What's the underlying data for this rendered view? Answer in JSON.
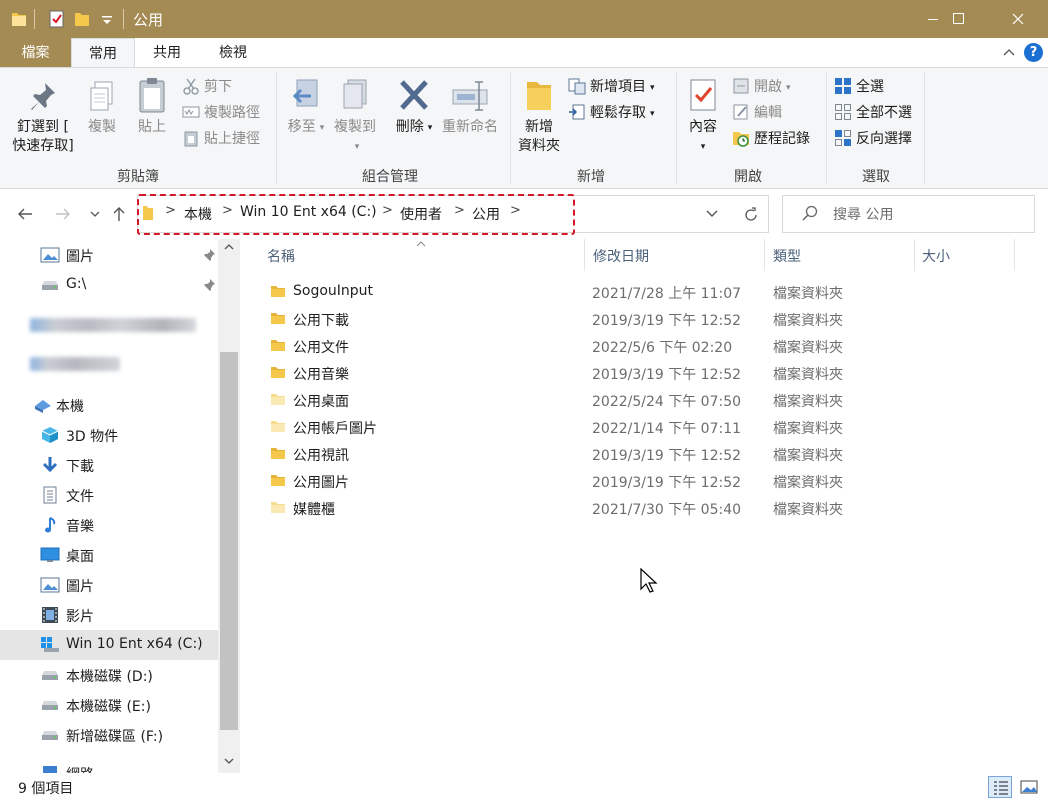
{
  "window": {
    "title": "公用"
  },
  "tabs": {
    "file": "檔案",
    "home": "常用",
    "share": "共用",
    "view": "檢視",
    "help": "?"
  },
  "ribbon": {
    "clipboard": {
      "label": "剪貼簿",
      "pin": "釘選到 [",
      "pin2": "快速存取]",
      "copy": "複製",
      "paste": "貼上",
      "cut": "剪下",
      "copy_path": "複製路徑",
      "paste_shortcut": "貼上捷徑"
    },
    "organize": {
      "label": "組合管理",
      "move_to": "移至",
      "copy_to": "複製到",
      "delete": "刪除",
      "rename": "重新命名"
    },
    "new": {
      "label": "新增",
      "new_folder": "新增",
      "new_folder2": "資料夾",
      "new_item": "新增項目",
      "easy_access": "輕鬆存取"
    },
    "open": {
      "label": "開啟",
      "properties": "內容",
      "open": "開啟",
      "edit": "編輯",
      "history": "歷程記錄"
    },
    "select": {
      "label": "選取",
      "select_all": "全選",
      "select_none": "全部不選",
      "invert": "反向選擇"
    }
  },
  "address": {
    "crumbs": [
      "本機",
      "Win 10 Ent x64 (C:)",
      "使用者",
      "公用"
    ],
    "search_placeholder": "搜尋 公用"
  },
  "nav": {
    "quick": [
      {
        "label": "圖片",
        "icon": "pictures-icon",
        "pinned": true
      },
      {
        "label": "G:\\",
        "icon": "drive-icon",
        "pinned": true
      }
    ],
    "this_pc": "本機",
    "items": [
      {
        "label": "3D 物件",
        "icon": "3d-objects-icon"
      },
      {
        "label": "下載",
        "icon": "download-icon"
      },
      {
        "label": "文件",
        "icon": "documents-icon"
      },
      {
        "label": "音樂",
        "icon": "music-icon"
      },
      {
        "label": "桌面",
        "icon": "desktop-icon"
      },
      {
        "label": "圖片",
        "icon": "pictures-icon"
      },
      {
        "label": "影片",
        "icon": "videos-icon"
      },
      {
        "label": "Win 10 Ent x64 (C:)",
        "icon": "windows-drive-icon",
        "selected": true
      },
      {
        "label": "本機磁碟 (D:)",
        "icon": "drive-icon"
      },
      {
        "label": "本機磁碟 (E:)",
        "icon": "drive-icon"
      },
      {
        "label": "新增磁碟區 (F:)",
        "icon": "drive-icon"
      }
    ],
    "partial": "網路"
  },
  "columns": {
    "name": "名稱",
    "modified": "修改日期",
    "type": "類型",
    "size": "大小"
  },
  "files": [
    {
      "name": "SogouInput",
      "modified": "2021/7/28 上午 11:07",
      "type": "檔案資料夾"
    },
    {
      "name": "公用下載",
      "modified": "2019/3/19 下午 12:52",
      "type": "檔案資料夾"
    },
    {
      "name": "公用文件",
      "modified": "2022/5/6 下午 02:20",
      "type": "檔案資料夾"
    },
    {
      "name": "公用音樂",
      "modified": "2019/3/19 下午 12:52",
      "type": "檔案資料夾"
    },
    {
      "name": "公用桌面",
      "modified": "2022/5/24 下午 07:50",
      "type": "檔案資料夾"
    },
    {
      "name": "公用帳戶圖片",
      "modified": "2022/1/14 下午 07:11",
      "type": "檔案資料夾"
    },
    {
      "name": "公用視訊",
      "modified": "2019/3/19 下午 12:52",
      "type": "檔案資料夾"
    },
    {
      "name": "公用圖片",
      "modified": "2019/3/19 下午 12:52",
      "type": "檔案資料夾"
    },
    {
      "name": "媒體櫃",
      "modified": "2021/7/30 下午 05:40",
      "type": "檔案資料夾"
    }
  ],
  "status": {
    "count": "9 個項目"
  },
  "colors": {
    "titlebar": "#a48a53",
    "highlight": "#d6172a",
    "folder": "#f5c84c"
  }
}
